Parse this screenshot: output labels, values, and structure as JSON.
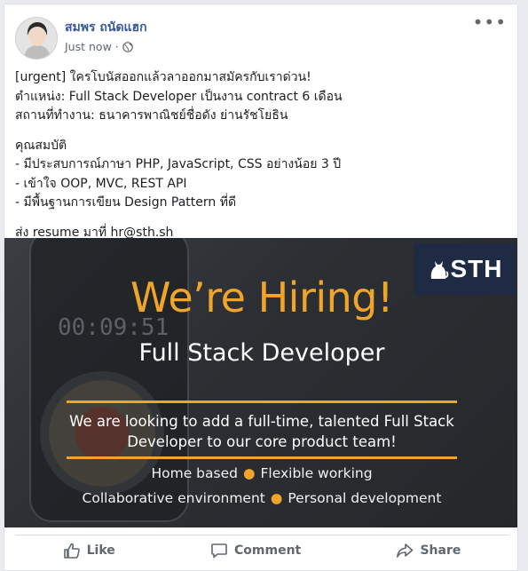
{
  "post": {
    "author": "สมพร ถนัดแฮก",
    "timestamp": "Just now",
    "separator": "·",
    "privacy_icon": "globe-icon",
    "more_icon": "more-options-icon",
    "text_lines": [
      "[urgent] ใครโบนัสออกแล้วลาออกมาสมัครกับเราด่วน!",
      "ตำแหน่ง: Full Stack Developer เป็นงาน contract 6 เดือน",
      "สถานที่ทำงาน: ธนาคารพาณิชย์ชื่อดัง ย่านรัชโยธิน",
      "คุณสมบัติ",
      "- มีประสบการณ์ภาษา PHP, JavaScript, CSS อย่างน้อย 3 ปี",
      "- เข้าใจ OOP, MVC, REST API",
      "- มีพื้นฐานการเขียน Design Pattern ที่ดี",
      "ส่ง resume มาที่ hr@sth.sh"
    ]
  },
  "image": {
    "logo_text": "STH",
    "phone_time": "00:09:51",
    "headline": "We’re Hiring!",
    "role": "Full Stack Developer",
    "desc_line1": "We are looking to add a full-time, talented Full Stack",
    "desc_line2": "Developer to our core product team!",
    "perk1": "Home based",
    "perk2": "Flexible working",
    "perk3": "Collaborative environment",
    "perk4": "Personal development",
    "accent": "#f0a52a"
  },
  "actions": {
    "like": "Like",
    "comment": "Comment",
    "share": "Share"
  }
}
